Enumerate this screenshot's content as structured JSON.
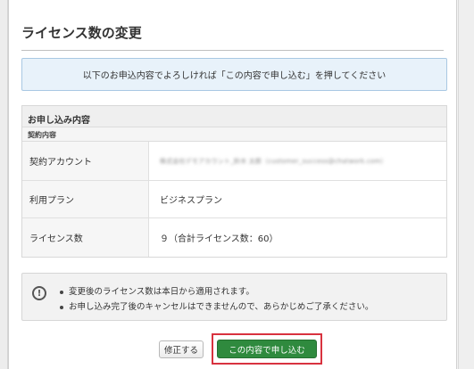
{
  "dialog": {
    "title": "ライセンス数の変更",
    "notice": "以下のお申込内容でよろしければ「この内容で申し込む」を押してください"
  },
  "details": {
    "section_title": "お申し込み内容",
    "subsection_title": "契約内容",
    "rows": [
      {
        "label": "契約アカウント",
        "value": "株式会社デモアカウント_鈴木 太郎（customer_success@chatwork.com）"
      },
      {
        "label": "利用プラン",
        "value": "ビジネスプラン"
      },
      {
        "label": "ライセンス数",
        "value": "９（合計ライセンス数：60）"
      }
    ]
  },
  "warnings": {
    "icon": "exclamation-circle-icon",
    "items": [
      "変更後のライセンス数は本日から適用されます。",
      "お申し込み完了後のキャンセルはできませんので、あらかじめご了承ください。"
    ]
  },
  "actions": {
    "fix_label": "修正する",
    "submit_label": "この内容で申し込む"
  },
  "colors": {
    "submit": "#2f8a3e",
    "highlight": "#d8323f",
    "notice_bg": "#e8f2fa"
  }
}
